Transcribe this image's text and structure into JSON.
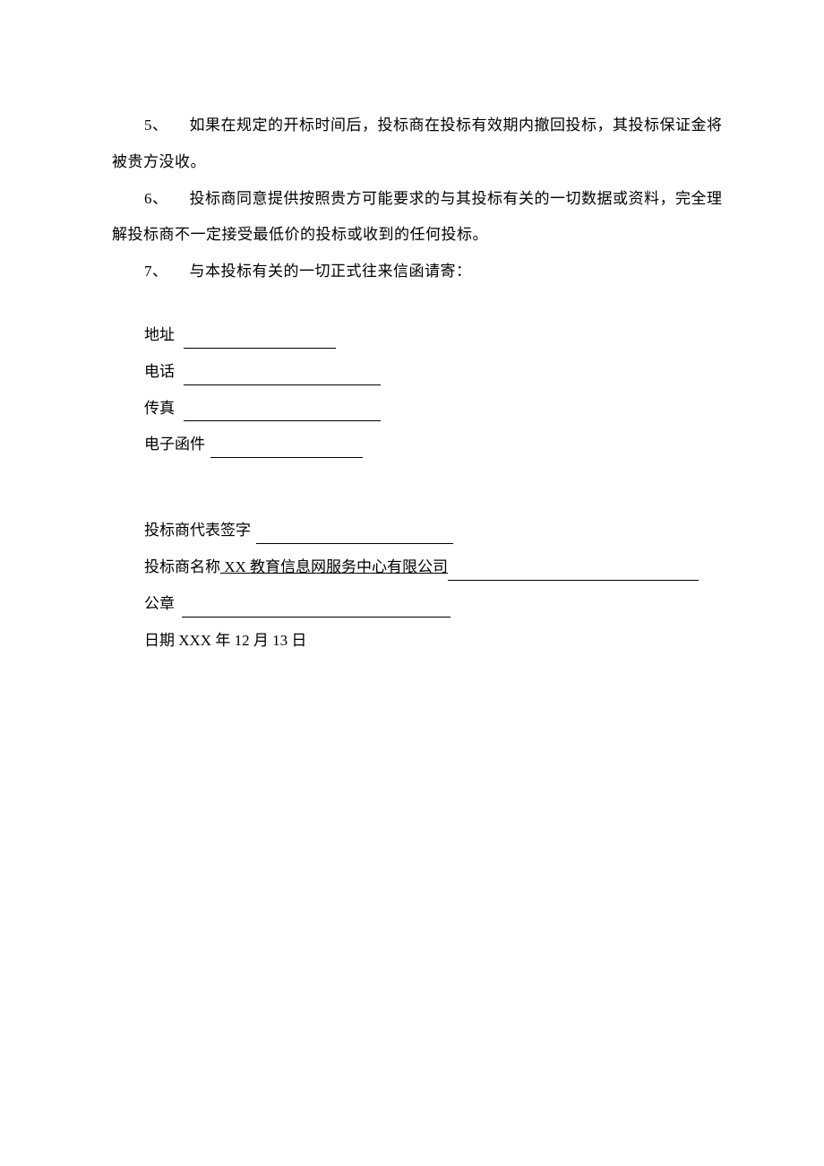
{
  "items": [
    {
      "number": "5、",
      "text": "如果在规定的开标时间后，投标商在投标有效期内撤回投标，其投标保证金将被贵方没收。"
    },
    {
      "number": "6、",
      "text": "投标商同意提供按照贵方可能要求的与其投标有关的一切数据或资料，完全理解投标商不一定接受最低价的投标或收到的任何投标。"
    },
    {
      "number": "7、",
      "text": "与本投标有关的一切正式往来信函请寄："
    }
  ],
  "contact": {
    "address_label": "地址",
    "phone_label": "电话",
    "fax_label": "传真",
    "email_label": "电子函件"
  },
  "signature": {
    "rep_sign_label": "投标商代表签字",
    "bidder_name_label": "投标商名称",
    "bidder_name_value": " XX 教育信息网服务中心有限公司",
    "seal_label": "公章",
    "date_label": "日期",
    "date_value": " XXX 年 12 月 13 日"
  }
}
